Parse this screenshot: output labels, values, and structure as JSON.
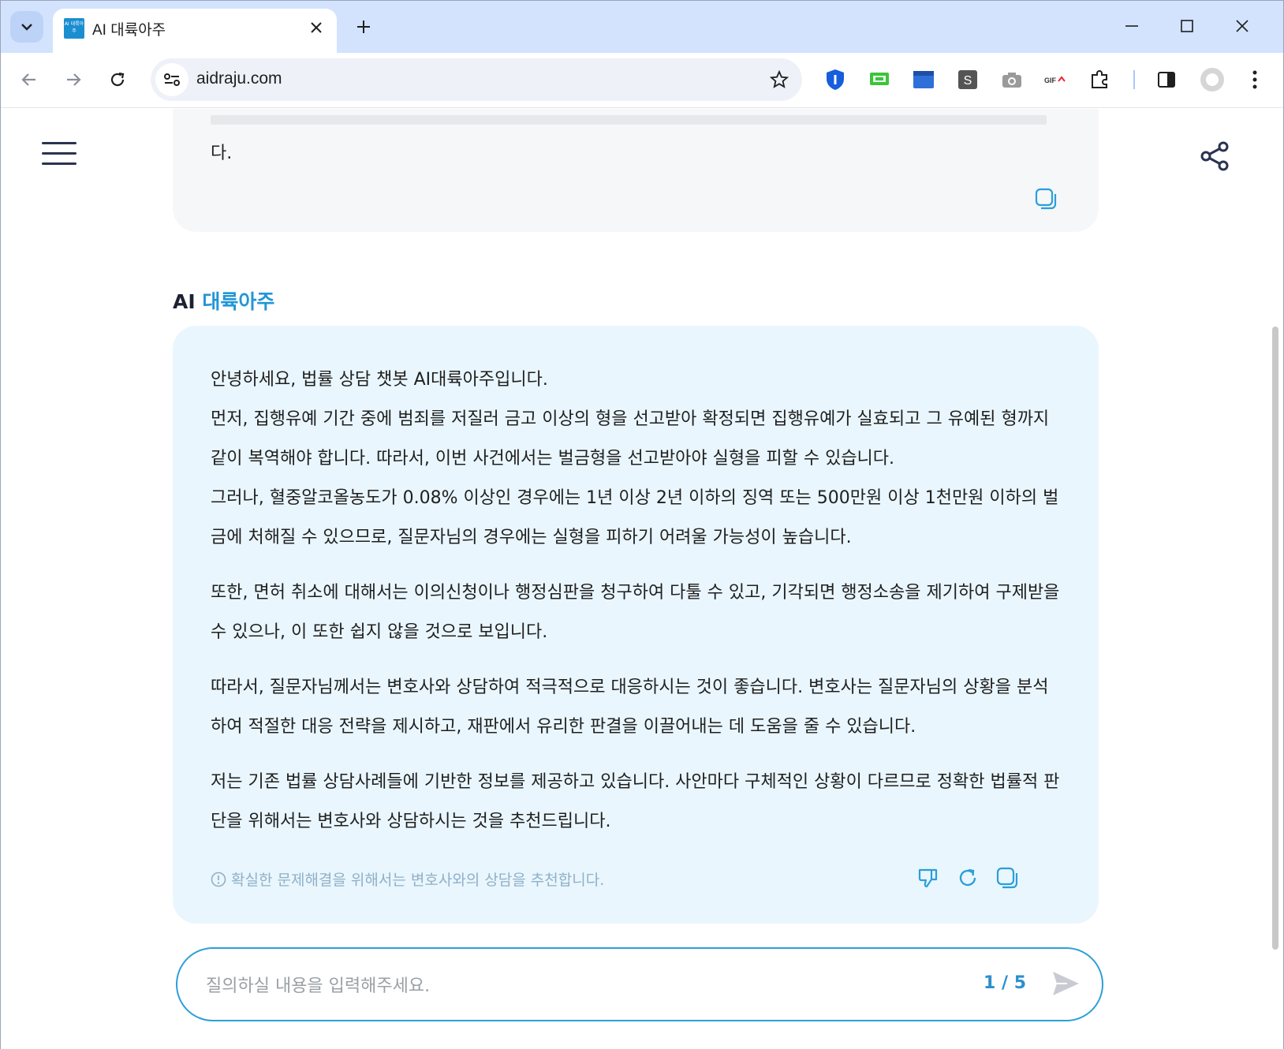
{
  "browser": {
    "tab_title": "AI 대륙아주",
    "favicon_text": "AI 대륙아주",
    "url": "aidraju.com",
    "new_tab_label": "+",
    "close_tab_label": "✕"
  },
  "page": {
    "previous_message_tail": "다.",
    "ai_label_prefix": "AI",
    "ai_label_brand": "대륙아주",
    "answer": {
      "paragraph1_line1": "안녕하세요, 법률 상담 챗봇 AI대륙아주입니다.",
      "paragraph1_line2": "먼저, 집행유예 기간 중에 범죄를 저질러 금고 이상의 형을 선고받아 확정되면 집행유예가 실효되고 그 유예된 형까지 같이 복역해야 합니다. 따라서, 이번 사건에서는 벌금형을 선고받아야 실형을 피할 수 있습니다.",
      "paragraph1_line3": "그러나, 혈중알코올농도가 0.08% 이상인 경우에는 1년 이상 2년 이하의 징역 또는 500만원 이상 1천만원 이하의 벌금에 처해질 수 있으므로, 질문자님의 경우에는 실형을 피하기 어려울 가능성이 높습니다.",
      "paragraph2": "또한, 면허 취소에 대해서는 이의신청이나 행정심판을 청구하여 다툴 수 있고, 기각되면 행정소송을 제기하여 구제받을 수 있으나, 이 또한 쉽지 않을 것으로 보입니다.",
      "paragraph3": "따라서, 질문자님께서는 변호사와 상담하여 적극적으로 대응하시는 것이 좋습니다. 변호사는 질문자님의 상황을 분석하여 적절한 대응 전략을 제시하고, 재판에서 유리한 판결을 이끌어내는 데 도움을 줄 수 있습니다.",
      "paragraph4": "저는 기존 법률 상담사례들에 기반한 정보를 제공하고 있습니다. 사안마다 구체적인 상황이 다르므로 정확한 법률적 판단을 위해서는 변호사와 상담하시는 것을 추천드립니다.",
      "disclaimer": "확실한 문제해결을 위해서는 변호사와의 상담을 추천합니다."
    },
    "input": {
      "placeholder": "질의하실 내용을 입력해주세요.",
      "counter": "1 / 5"
    }
  },
  "colors": {
    "accent": "#2196d6",
    "answer_bg": "#e9f6fd",
    "tabstrip_bg": "#d3e3fd"
  }
}
